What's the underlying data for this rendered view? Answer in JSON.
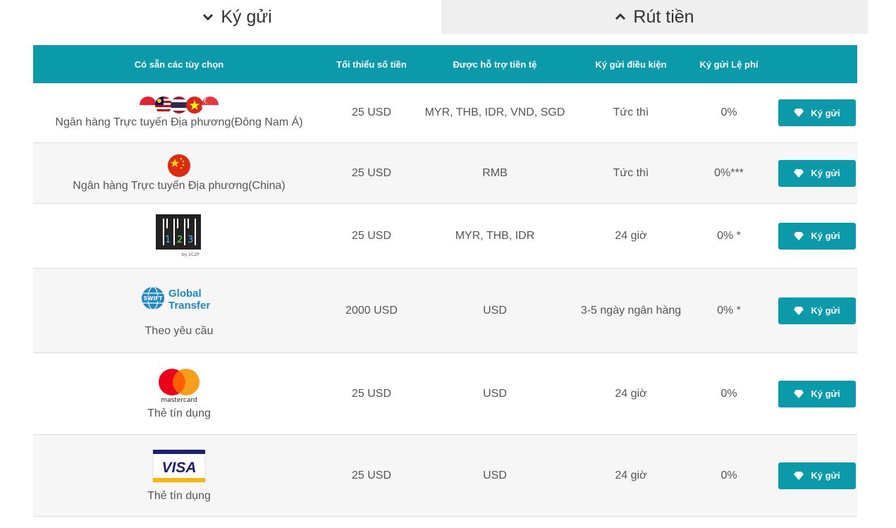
{
  "tabs": {
    "deposit": "Ký gửi",
    "withdraw": "Rút tiền"
  },
  "table": {
    "headers": {
      "options": "Có sẵn các tùy chọn",
      "min_amount": "Tối thiểu số tiền",
      "currencies": "Được hỗ trợ tiền tệ",
      "condition": "Ký gửi điều kiện",
      "fee": "Ký gửi Lệ phí"
    },
    "rows": [
      {
        "label": "Ngân hàng Trực tuyến Địa phương(Đông Nam Á)",
        "logo": "sea-flags-icon",
        "min": "25 USD",
        "currencies": "MYR, THB, IDR, VND, SGD",
        "condition": "Tức thì",
        "fee": "0%",
        "button": "Ký gửi"
      },
      {
        "label": "Ngân hàng Trực tuyến Địa phương(China)",
        "logo": "china-flag-icon",
        "min": "25 USD",
        "currencies": "RMB",
        "condition": "Tức thì",
        "fee": "0%***",
        "button": "Ký gửi"
      },
      {
        "label": "",
        "logo": "123-by-2c2p-logo",
        "logo_text": "by 2C2P",
        "min": "25 USD",
        "currencies": "MYR, THB, IDR",
        "condition": "24 giờ",
        "fee": "0% *",
        "button": "Ký gửi"
      },
      {
        "label": "Theo yêu cầu",
        "logo": "swift-global-transfer-logo",
        "logo_text": [
          "SWIFT",
          "Global",
          "Transfer"
        ],
        "min": "2000 USD",
        "currencies": "USD",
        "condition": "3-5 ngày ngân hàng",
        "fee": "0% *",
        "button": "Ký gửi"
      },
      {
        "label": "Thẻ tín dụng",
        "logo": "mastercard-logo",
        "logo_text": "mastercard",
        "min": "25 USD",
        "currencies": "USD",
        "condition": "24 giờ",
        "fee": "0%",
        "button": "Ký gửi"
      },
      {
        "label": "Thẻ tín dụng",
        "logo": "visa-logo",
        "logo_text": "VISA",
        "min": "25 USD",
        "currencies": "USD",
        "condition": "24 giờ",
        "fee": "0%",
        "button": "Ký gửi"
      }
    ]
  },
  "colors": {
    "accent": "#0b9aa9",
    "tab_inactive": "#efefef"
  }
}
